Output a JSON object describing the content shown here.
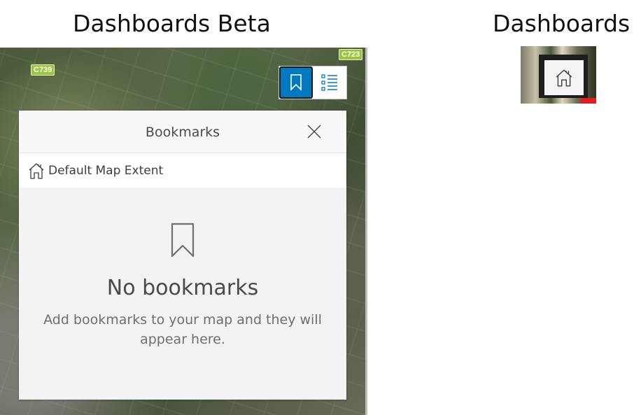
{
  "headings": {
    "left": "Dashboards Beta",
    "right": "Dashboards"
  },
  "map": {
    "road_labels": [
      "C739",
      "C723"
    ]
  },
  "widget_toolbar": {
    "bookmarks_icon": "bookmark-icon",
    "layer_list_icon": "layer-list-icon",
    "active": "bookmarks",
    "accent_color": "#0079c1"
  },
  "bookmarks_panel": {
    "title": "Bookmarks",
    "close_icon": "close-icon",
    "default_extent_label": "Default Map Extent",
    "default_extent_icon": "home-icon",
    "empty_title": "No bookmarks",
    "empty_description": "Add bookmarks to your map and they will appear here."
  },
  "thumbnail": {
    "home_icon": "home-icon"
  }
}
